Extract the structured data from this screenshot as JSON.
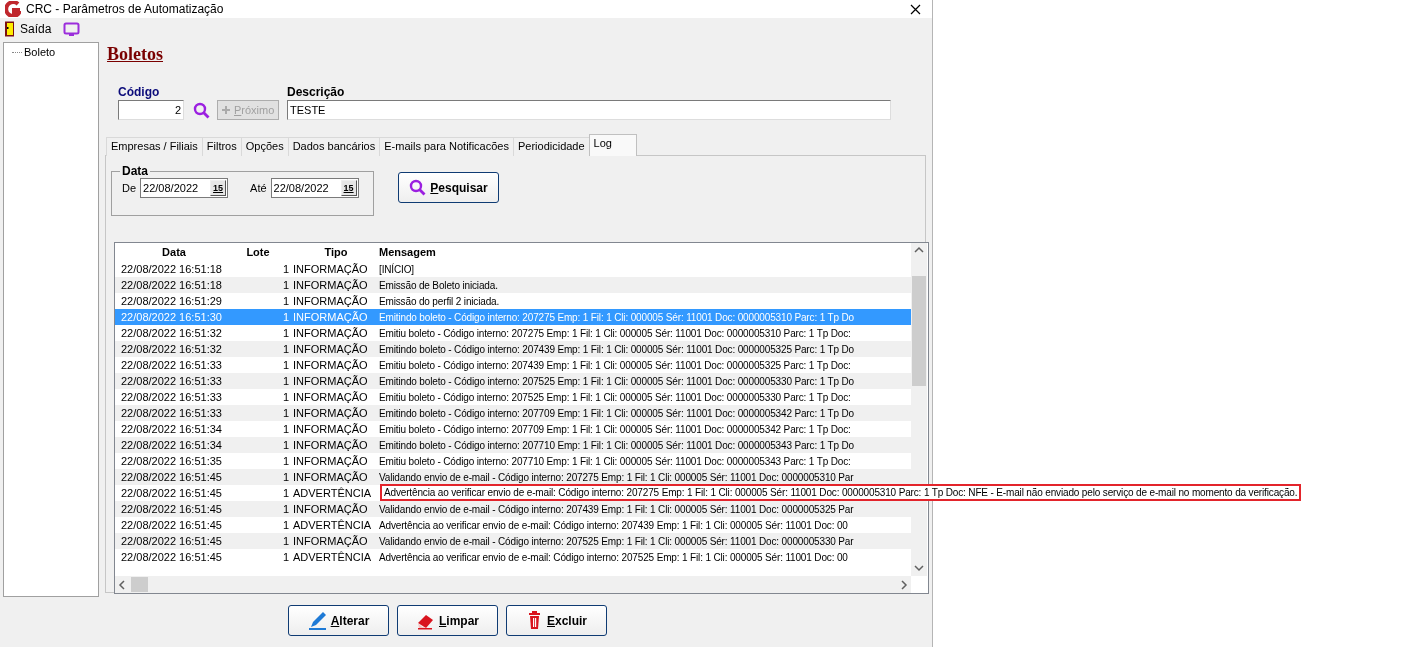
{
  "window": {
    "title": "CRC - Parâmetros de Automatização"
  },
  "menu": {
    "items": [
      {
        "kind": "exit",
        "label": "Saída"
      },
      {
        "kind": "screen"
      }
    ]
  },
  "tree": {
    "items": [
      {
        "label": "Boleto"
      }
    ]
  },
  "heading": "Boletos",
  "form": {
    "code_label": "Código",
    "code_value": "2",
    "next_button": {
      "label": "Próximo",
      "disabled": true
    },
    "description_label": "Descrição",
    "description_value": "TESTE"
  },
  "tabs": [
    {
      "label": "Empresas / Filiais",
      "selected": false
    },
    {
      "label": "Filtros",
      "selected": false
    },
    {
      "label": "Opções",
      "selected": false
    },
    {
      "label": "Dados bancários",
      "selected": false
    },
    {
      "label": "E-mails para Notificacões",
      "selected": false
    },
    {
      "label": "Periodicidade",
      "selected": false
    },
    {
      "label": "Log",
      "selected": true
    }
  ],
  "filter": {
    "group_label": "Data",
    "from_label": "De",
    "from_value": "22/08/2022",
    "to_label": "Até",
    "to_value": "22/08/2022",
    "from_calendar": "15",
    "to_calendar": "15",
    "search_button": "Pesquisar"
  },
  "table": {
    "columns": [
      "Data",
      "Lote",
      "Tipo",
      "Mensagem"
    ],
    "rows": [
      {
        "date": "22/08/2022 16:51:18",
        "batch": "1",
        "type": "INFORMAÇÃO",
        "message": "[INÍCIO]",
        "selected": false
      },
      {
        "date": "22/08/2022 16:51:18",
        "batch": "1",
        "type": "INFORMAÇÃO",
        "message": "Emissão de Boleto iniciada.",
        "selected": false
      },
      {
        "date": "22/08/2022 16:51:29",
        "batch": "1",
        "type": "INFORMAÇÃO",
        "message": "Emissão do perfil 2 iniciada.",
        "selected": false
      },
      {
        "date": "22/08/2022 16:51:30",
        "batch": "1",
        "type": "INFORMAÇÃO",
        "message": "Emitindo boleto - Código interno: 207275 Emp: 1 Fil: 1 Cli: 000005 Sér: 11001 Doc: 0000005310 Parc: 1 Tp Do",
        "selected": true
      },
      {
        "date": "22/08/2022 16:51:32",
        "batch": "1",
        "type": "INFORMAÇÃO",
        "message": "Emitiu boleto - Código interno: 207275 Emp: 1 Fil: 1 Cli: 000005 Sér: 11001 Doc: 0000005310 Parc: 1 Tp Doc:",
        "selected": false
      },
      {
        "date": "22/08/2022 16:51:32",
        "batch": "1",
        "type": "INFORMAÇÃO",
        "message": "Emitindo boleto - Código interno: 207439 Emp: 1 Fil: 1 Cli: 000005 Sér: 11001 Doc: 0000005325 Parc: 1 Tp Do",
        "selected": false
      },
      {
        "date": "22/08/2022 16:51:33",
        "batch": "1",
        "type": "INFORMAÇÃO",
        "message": "Emitiu boleto - Código interno: 207439 Emp: 1 Fil: 1 Cli: 000005 Sér: 11001 Doc: 0000005325 Parc: 1 Tp Doc:",
        "selected": false
      },
      {
        "date": "22/08/2022 16:51:33",
        "batch": "1",
        "type": "INFORMAÇÃO",
        "message": "Emitindo boleto - Código interno: 207525 Emp: 1 Fil: 1 Cli: 000005 Sér: 11001 Doc: 0000005330 Parc: 1 Tp Do",
        "selected": false
      },
      {
        "date": "22/08/2022 16:51:33",
        "batch": "1",
        "type": "INFORMAÇÃO",
        "message": "Emitiu boleto - Código interno: 207525 Emp: 1 Fil: 1 Cli: 000005 Sér: 11001 Doc: 0000005330 Parc: 1 Tp Doc:",
        "selected": false
      },
      {
        "date": "22/08/2022 16:51:33",
        "batch": "1",
        "type": "INFORMAÇÃO",
        "message": "Emitindo boleto - Código interno: 207709 Emp: 1 Fil: 1 Cli: 000005 Sér: 11001 Doc: 0000005342 Parc: 1 Tp Do",
        "selected": false
      },
      {
        "date": "22/08/2022 16:51:34",
        "batch": "1",
        "type": "INFORMAÇÃO",
        "message": "Emitiu boleto - Código interno: 207709 Emp: 1 Fil: 1 Cli: 000005 Sér: 11001 Doc: 0000005342 Parc: 1 Tp Doc:",
        "selected": false
      },
      {
        "date": "22/08/2022 16:51:34",
        "batch": "1",
        "type": "INFORMAÇÃO",
        "message": "Emitindo boleto - Código interno: 207710 Emp: 1 Fil: 1 Cli: 000005 Sér: 11001 Doc: 0000005343 Parc: 1 Tp Do",
        "selected": false
      },
      {
        "date": "22/08/2022 16:51:35",
        "batch": "1",
        "type": "INFORMAÇÃO",
        "message": "Emitiu boleto - Código interno: 207710 Emp: 1 Fil: 1 Cli: 000005 Sér: 11001 Doc: 0000005343 Parc: 1 Tp Doc:",
        "selected": false
      },
      {
        "date": "22/08/2022 16:51:45",
        "batch": "1",
        "type": "INFORMAÇÃO",
        "message": "Validando envio de e-mail - Código interno: 207275 Emp: 1 Fil: 1 Cli: 000005 Sér: 11001 Doc: 0000005310 Par",
        "selected": false
      },
      {
        "date": "22/08/2022 16:51:45",
        "batch": "1",
        "type": "ADVERTÊNCIA",
        "message": "Advertência ao verificar envio de e-mail: Código interno: 207275 Emp: 1 Fil: 1 Cli: 000005 Sér: 11001 Doc: 0000005310 Parc: 1 Tp Doc: NFE - E-mail não enviado pelo serviço de e-mail no momento da verificação.",
        "selected": false,
        "tooltip": true
      },
      {
        "date": "22/08/2022 16:51:45",
        "batch": "1",
        "type": "INFORMAÇÃO",
        "message": "Validando envio de e-mail - Código interno: 207439 Emp: 1 Fil: 1 Cli: 000005 Sér: 11001 Doc: 0000005325 Par",
        "selected": false
      },
      {
        "date": "22/08/2022 16:51:45",
        "batch": "1",
        "type": "ADVERTÊNCIA",
        "message": "Advertência ao verificar envio de e-mail: Código interno: 207439 Emp: 1 Fil: 1 Cli: 000005 Sér: 11001 Doc: 00",
        "selected": false
      },
      {
        "date": "22/08/2022 16:51:45",
        "batch": "1",
        "type": "INFORMAÇÃO",
        "message": "Validando envio de e-mail - Código interno: 207525 Emp: 1 Fil: 1 Cli: 000005 Sér: 11001 Doc: 0000005330 Par",
        "selected": false
      },
      {
        "date": "22/08/2022 16:51:45",
        "batch": "1",
        "type": "ADVERTÊNCIA",
        "message": "Advertência ao verificar envio de e-mail: Código interno: 207525 Emp: 1 Fil: 1 Cli: 000005 Sér: 11001 Doc: 00",
        "selected": false
      }
    ]
  },
  "actions": [
    {
      "kind": "edit",
      "label": "Alterar"
    },
    {
      "kind": "clear",
      "label": "Limpar"
    },
    {
      "kind": "delete",
      "label": "Excluir"
    }
  ]
}
